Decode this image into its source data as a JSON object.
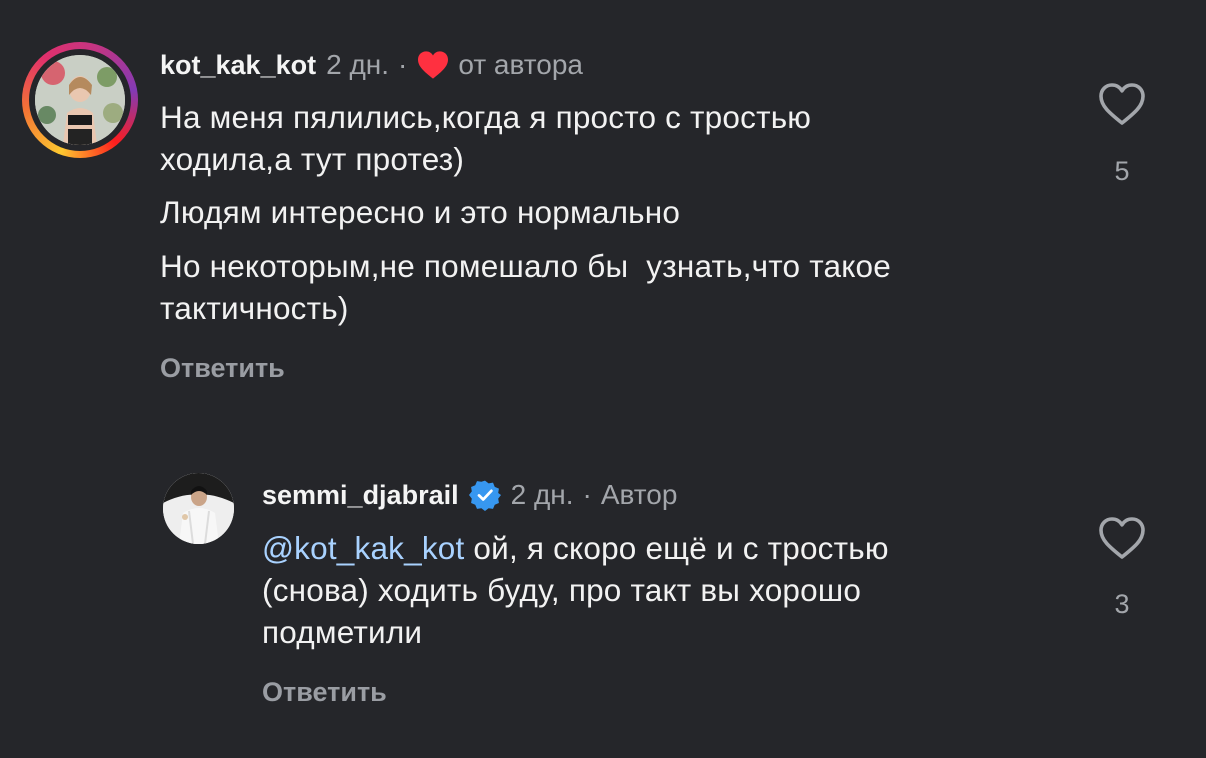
{
  "comments": [
    {
      "username": "kot_kak_kot",
      "time": "2 дн.",
      "separator": "·",
      "liked_by_author": "от автора",
      "paragraphs": [
        "На меня пялились,когда я просто с тростью",
        "ходила,а тут протез)",
        "Людям интересно и это нормально",
        "Но некоторым,не помешало бы  узнать,что такое",
        "тактичность)"
      ],
      "reply_label": "Ответить",
      "likes": "5",
      "avatar_ring_colors": [
        "#fdc830",
        "#f37335",
        "#e1306c",
        "#c13584",
        "#833ab4"
      ]
    },
    {
      "username": "semmi_djabrail",
      "time": "2 дн.",
      "separator": "·",
      "author_badge": "Автор",
      "mention": "@kot_kak_kot",
      "lines": [
        " ой, я скоро ещё и с тростью",
        "(снова) ходить буду, про такт вы хорошо",
        "подметили"
      ],
      "reply_label": "Ответить",
      "likes": "3",
      "verified_color": "#3797f0"
    }
  ],
  "colors": {
    "background": "#25262a",
    "text": "#f2f2f2",
    "muted": "#a3a6ab",
    "mention": "#a9d2ff",
    "heart_red": "#ff3040"
  }
}
